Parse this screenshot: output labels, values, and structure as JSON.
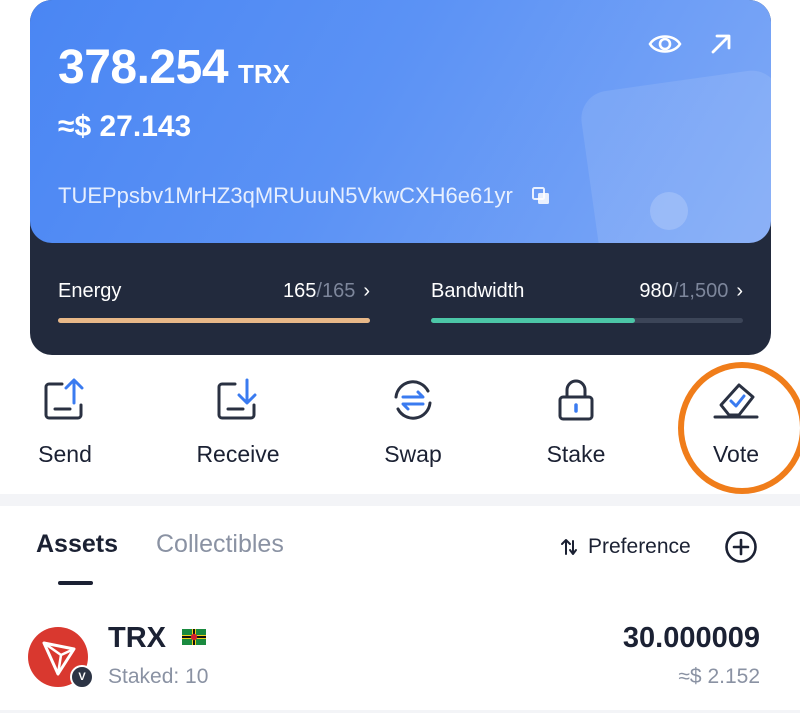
{
  "wallet": {
    "balance": "378.254",
    "unit": "TRX",
    "fiat": "≈$ 27.143",
    "address": "TUEPpsbv1MrHZ3qMRUuuN5VkwCXH6e61yr"
  },
  "resources": {
    "energy": {
      "label": "Energy",
      "current": "165",
      "max": "165",
      "fill_fraction": 1.0,
      "color": "#e8b888"
    },
    "bandwidth": {
      "label": "Bandwidth",
      "current": "980",
      "max": "1,500",
      "fill_fraction": 0.653,
      "color": "#4cc6a7"
    }
  },
  "actions": [
    {
      "label": "Send",
      "icon": "send-icon"
    },
    {
      "label": "Receive",
      "icon": "receive-icon"
    },
    {
      "label": "Swap",
      "icon": "swap-icon"
    },
    {
      "label": "Stake",
      "icon": "lock-icon"
    },
    {
      "label": "Vote",
      "icon": "vote-icon"
    }
  ],
  "highlight_color": "#f07d1a",
  "tabs": [
    {
      "label": "Assets",
      "active": true
    },
    {
      "label": "Collectibles",
      "active": false
    }
  ],
  "preference_label": "Preference",
  "token": {
    "name": "TRX",
    "staked": "Staked: 10",
    "amount": "30.000009",
    "fiat": "≈$ 2.152",
    "badge": "V"
  }
}
